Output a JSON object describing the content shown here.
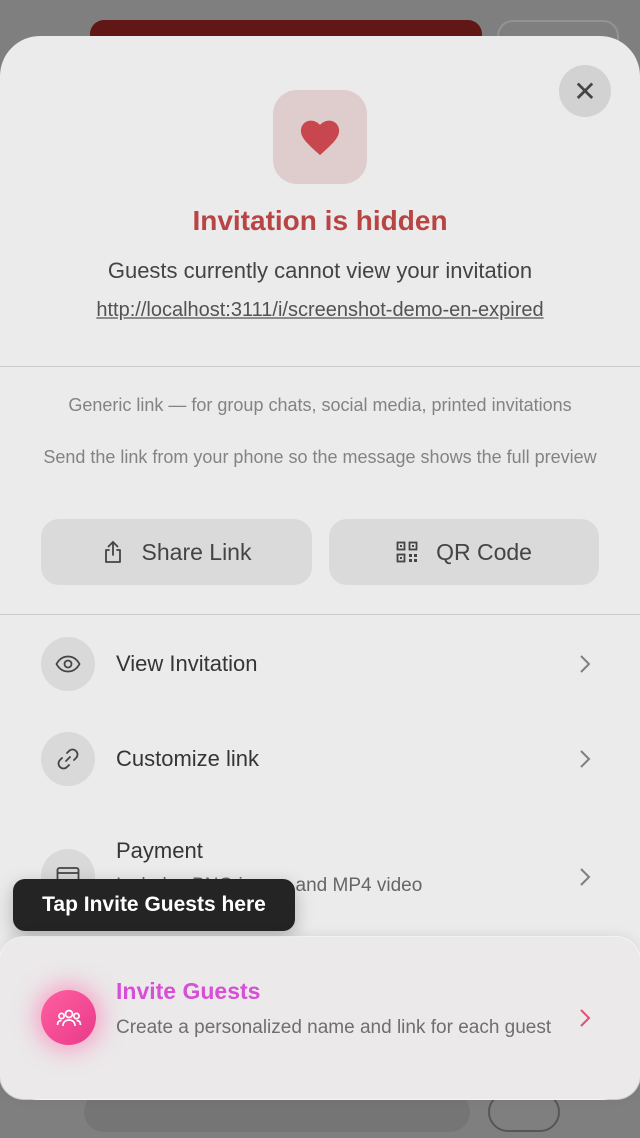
{
  "close_glyph": "✕",
  "header": {
    "title": "Invitation is hidden",
    "subtitle": "Guests currently cannot view your invitation",
    "link": "http://localhost:3111/i/screenshot-demo-en-expired"
  },
  "share": {
    "generic_note": "Generic link — for group chats, social media, printed invitations",
    "send_note": "Send the link from your phone so the message shows the full preview",
    "share_button": "Share Link",
    "qr_button": "QR Code"
  },
  "menu": {
    "view_invitation": "View Invitation",
    "customize_link": "Customize link",
    "payment_title": "Payment",
    "payment_sub": "Includes PNG image and MP4 video"
  },
  "tooltip": "Tap Invite Guests here",
  "invite": {
    "title": "Invite Guests",
    "desc": "Create a personalized name and link for each guest"
  },
  "colors": {
    "title_red": "#c94a4a",
    "invite_magenta": "#d64fd6",
    "invite_icon_pink": "#f0479a"
  }
}
